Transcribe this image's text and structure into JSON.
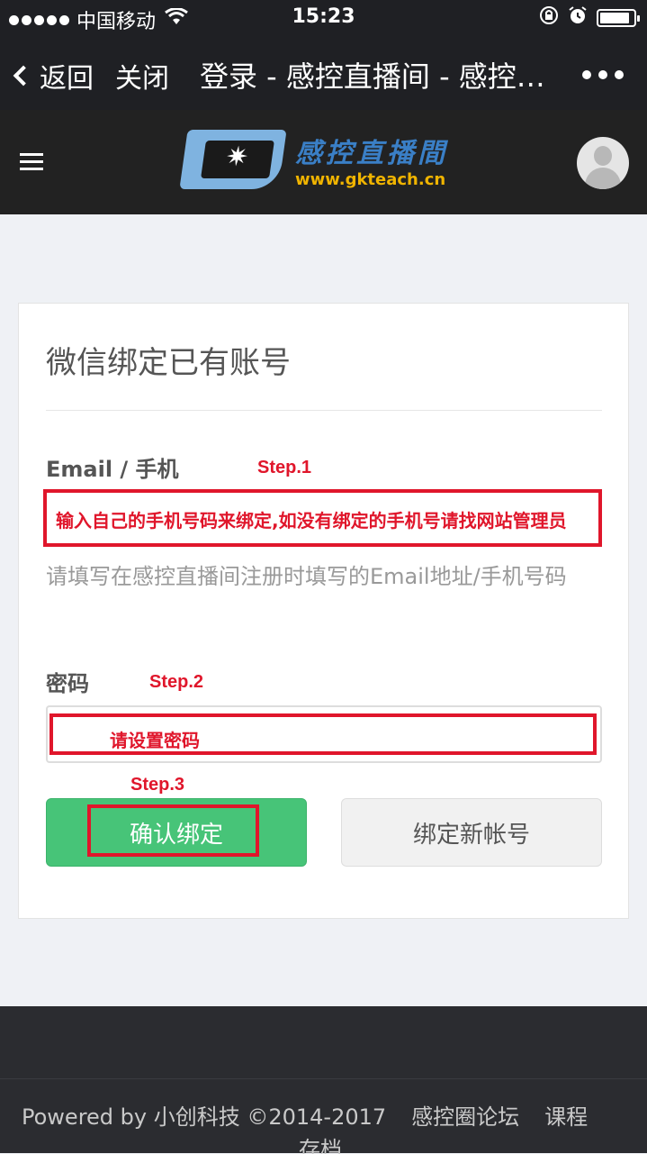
{
  "status_bar": {
    "carrier": "中国移动",
    "time": "15:23",
    "battery_level": 0.9
  },
  "nav_bar": {
    "back_label": "返回",
    "close_label": "关闭",
    "title": "登录 - 感控直播间 - 感控直播间"
  },
  "site_header": {
    "logo_name": "感控直播間",
    "logo_url": "www.gkteach.cn"
  },
  "form": {
    "title": "微信绑定已有账号",
    "email_label": "Email / 手机",
    "email_help": "请填写在感控直播间注册时填写的Email地址/手机号码",
    "password_label": "密码",
    "password_value": "",
    "confirm_button": "确认绑定",
    "new_account_button": "绑定新帐号"
  },
  "annotations": {
    "step1_label": "Step.1",
    "step1_text": "输入自己的手机号码来绑定,如没有绑定的手机号请找网站管理员",
    "step2_label": "Step.2",
    "step2_text": "请设置密码",
    "step3_label": "Step.3",
    "color": "#e0162b"
  },
  "footer": {
    "powered": "Powered by 小创科技 ©2014-2017",
    "forum_link": "感控圈论坛",
    "course_link": "课程",
    "archive_link": "存档"
  }
}
